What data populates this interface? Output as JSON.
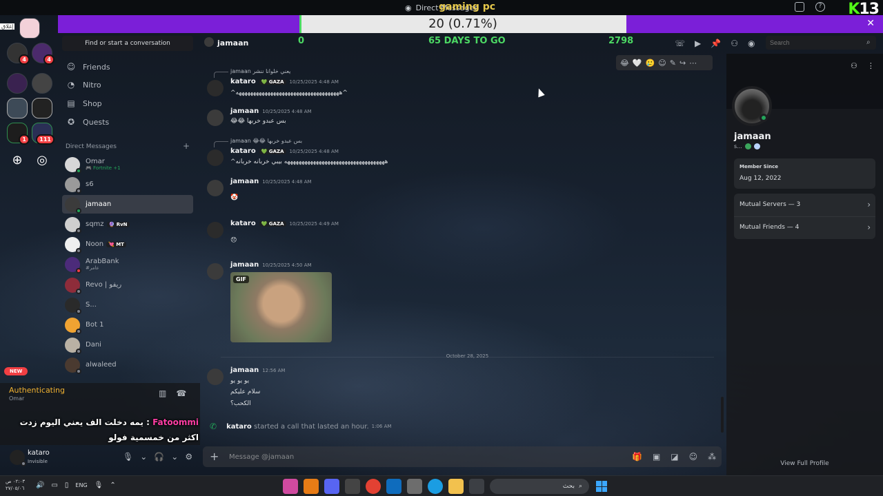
{
  "window": {
    "title": "Direct Messages",
    "overlay_title": "gaming pc",
    "stream_badge": {
      "k": "K",
      "num": "13"
    }
  },
  "goal": {
    "label": "20 (0.71%)",
    "progress": 0.0071,
    "start": "0",
    "days_left": "65 DAYS TO GO",
    "target": "2798",
    "close": "✕"
  },
  "server_rail": {
    "tiny_label": "إغلاق",
    "badges": {
      "s2": "4",
      "s1": "4",
      "s9": "1",
      "s10": "111"
    }
  },
  "sidebar": {
    "find_placeholder": "Find or start a conversation",
    "nav": [
      {
        "label": "Friends",
        "icon": "friends-icon"
      },
      {
        "label": "Nitro",
        "icon": "nitro-icon"
      },
      {
        "label": "Shop",
        "icon": "shop-icon"
      },
      {
        "label": "Quests",
        "icon": "quests-icon"
      }
    ],
    "dm_header": "Direct Messages",
    "dm_add": "+",
    "dms": [
      {
        "name": "Omar",
        "sub": "🎮 Fortnite +1",
        "status": "online"
      },
      {
        "name": "s6",
        "sub": "",
        "status": "offline"
      },
      {
        "name": "jamaan",
        "sub": "",
        "status": "online"
      },
      {
        "name": "sqmz",
        "tag": "🔮 RvN",
        "status": "offline"
      },
      {
        "name": "Noon",
        "tag": "💘 MT",
        "status": "offline"
      },
      {
        "name": "ArabBank",
        "sub": "#عامر",
        "status": "dnd"
      },
      {
        "name": "Revo | ريفو",
        "sub": "",
        "status": "offline"
      },
      {
        "name": "S...",
        "sub": "",
        "status": "offline"
      },
      {
        "name": "Bot 1",
        "sub": "",
        "status": "offline"
      },
      {
        "name": "Dani",
        "sub": "",
        "status": "offline"
      },
      {
        "name": "alwaleed",
        "sub": "",
        "status": "offline"
      }
    ]
  },
  "voice": {
    "new_badge": "NEW",
    "status": "Authenticating",
    "channel": "Omar"
  },
  "overlay_chat": {
    "who": "Fatoommi",
    "text": "يمه دخلت الف يعني اليوم زدت اكثر من خمسمية فولو"
  },
  "user_panel": {
    "name": "kataro",
    "status": "Invisible"
  },
  "chat": {
    "recipient": "jamaan",
    "search_placeholder": "Search",
    "composer_placeholder": "Message @jamaan",
    "messages": [
      {
        "reply": "jamaan  يعني خلوانا ننشر"
      },
      {
        "author": "kataro",
        "tag": "💚 GAZA",
        "time": "10/25/2025 4:48 AM",
        "body": "^ههههههههههههههههههههههههههههههههههههه^"
      },
      {
        "author": "jamaan",
        "time": "10/25/2025 4:48 AM",
        "body": "😂😂 بس عبدو خربها"
      },
      {
        "reply": "jamaan 😂😂 بس عبدو خربها"
      },
      {
        "author": "kataro",
        "tag": "💚 GAZA",
        "time": "10/25/2025 4:48 AM",
        "body": "^هههههههههههههههههههههههههههههههههههه بيبي خربانه خربانه"
      },
      {
        "author": "jamaan",
        "time": "10/25/2025 4:48 AM",
        "body": "🤡"
      },
      {
        "author": "kataro",
        "tag": "💚 GAZA",
        "time": "10/25/2025 4:49 AM",
        "body": "😞"
      },
      {
        "author": "jamaan",
        "time": "10/25/2025 4:50 AM",
        "gif": "GIF"
      },
      {
        "author": "jamaan",
        "time": "12:56 AM",
        "lines": [
          "يو يو يو",
          "سلام عليكم",
          "الكحب؟"
        ]
      }
    ],
    "date_divider": "October 28, 2025",
    "call": {
      "author": "kataro",
      "text": "started a call that lasted an hour.",
      "time": "1:06 AM"
    }
  },
  "profile": {
    "name": "jamaan",
    "tag": "s...",
    "member_since_label": "Member Since",
    "member_since": "Aug 12, 2022",
    "mutual_servers": "Mutual Servers — 3",
    "mutual_friends": "Mutual Friends — 4",
    "view_full": "View Full Profile"
  },
  "taskbar": {
    "time": "٠٢:٠٣ ص",
    "date": "٢٧/٠٥/٠٦",
    "lang": "ENG",
    "search_text": "بحث"
  },
  "colors": {
    "accent_purple": "#7b1fd8",
    "progress_green": "#4cd964",
    "online": "#23a55a",
    "dnd": "#f23f43"
  }
}
